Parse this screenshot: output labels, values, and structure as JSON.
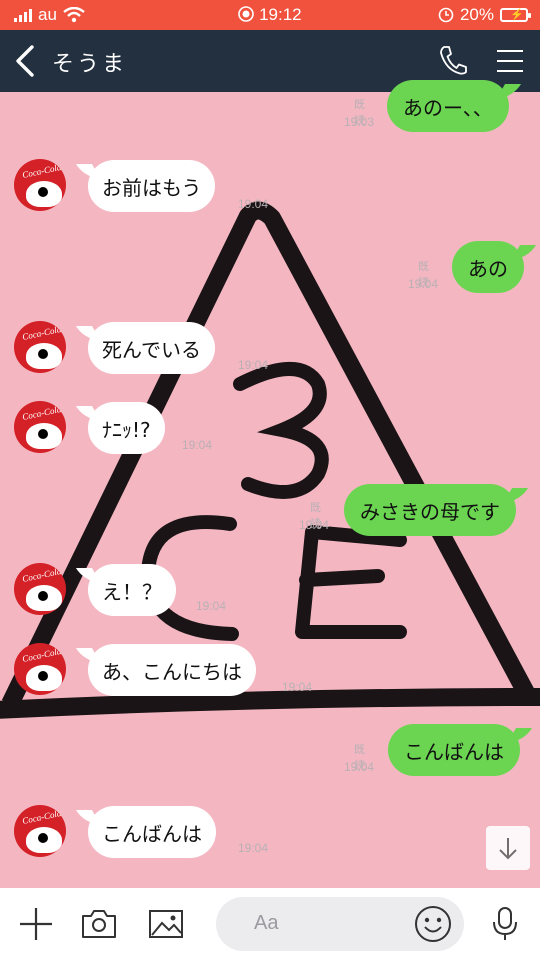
{
  "status_bar": {
    "carrier": "au",
    "time": "19:12",
    "battery": "20%"
  },
  "header": {
    "contact_name": "そうま"
  },
  "messages": [
    {
      "side": "out",
      "text": "あのー、、",
      "read": "既読",
      "time": "19:03"
    },
    {
      "side": "in",
      "text": "お前はもう",
      "time": "19:04"
    },
    {
      "side": "out",
      "text": "あの",
      "read": "既読",
      "time": "19:04"
    },
    {
      "side": "in",
      "text": "死んでいる",
      "time": "19:04"
    },
    {
      "side": "in",
      "text": "ﾅﾆｯ!?",
      "time": "19:04"
    },
    {
      "side": "out",
      "text": "みさきの母です",
      "read": "既読",
      "time": "19:04"
    },
    {
      "side": "in",
      "text": "え！？",
      "time": "19:04"
    },
    {
      "side": "in",
      "text": "あ、こんにちは",
      "time": "19:04"
    },
    {
      "side": "out",
      "text": "こんばんは",
      "read": "既読",
      "time": "19:04"
    },
    {
      "side": "in",
      "text": "こんばんは",
      "time": "19:04"
    }
  ],
  "avatar_label": "Coca-Cola",
  "input": {
    "placeholder": "Aa"
  },
  "icons": [
    "back-chevron-icon",
    "phone-icon",
    "menu-icon",
    "plus-icon",
    "camera-icon",
    "image-icon",
    "emoji-icon",
    "microphone-icon",
    "arrow-down-icon",
    "wifi-icon",
    "alarm-icon"
  ],
  "colors": {
    "status_bar": "#f0523d",
    "header": "#23303f",
    "chat_background": "#f4b7c2",
    "outgoing_bubble": "#6bd552",
    "incoming_bubble": "#ffffff"
  }
}
